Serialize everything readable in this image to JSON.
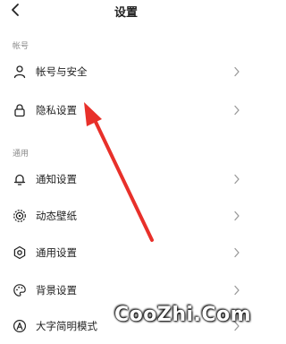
{
  "header": {
    "title": "设置",
    "back_icon": "chevron-left-icon"
  },
  "sections": [
    {
      "label": "帐号",
      "items": [
        {
          "label": "帐号与安全",
          "icon": "user-icon"
        },
        {
          "label": "隐私设置",
          "icon": "lock-icon"
        }
      ]
    },
    {
      "label": "通用",
      "items": [
        {
          "label": "通知设置",
          "icon": "bell-icon"
        },
        {
          "label": "动态壁纸",
          "icon": "dynamic-wallpaper-icon"
        },
        {
          "label": "通用设置",
          "icon": "gear-icon"
        },
        {
          "label": "背景设置",
          "icon": "palette-icon"
        },
        {
          "label": "大字简明模式",
          "icon": "font-size-icon"
        }
      ]
    }
  ],
  "watermark": "CooZhi.Com",
  "annotation": {
    "color": "#e8302a",
    "points_to": "隐私设置"
  },
  "colors": {
    "background": "#ffffff",
    "text": "#222222",
    "section_label": "#8a8a8a",
    "chevron": "#999999",
    "arrow": "#e8302a"
  }
}
